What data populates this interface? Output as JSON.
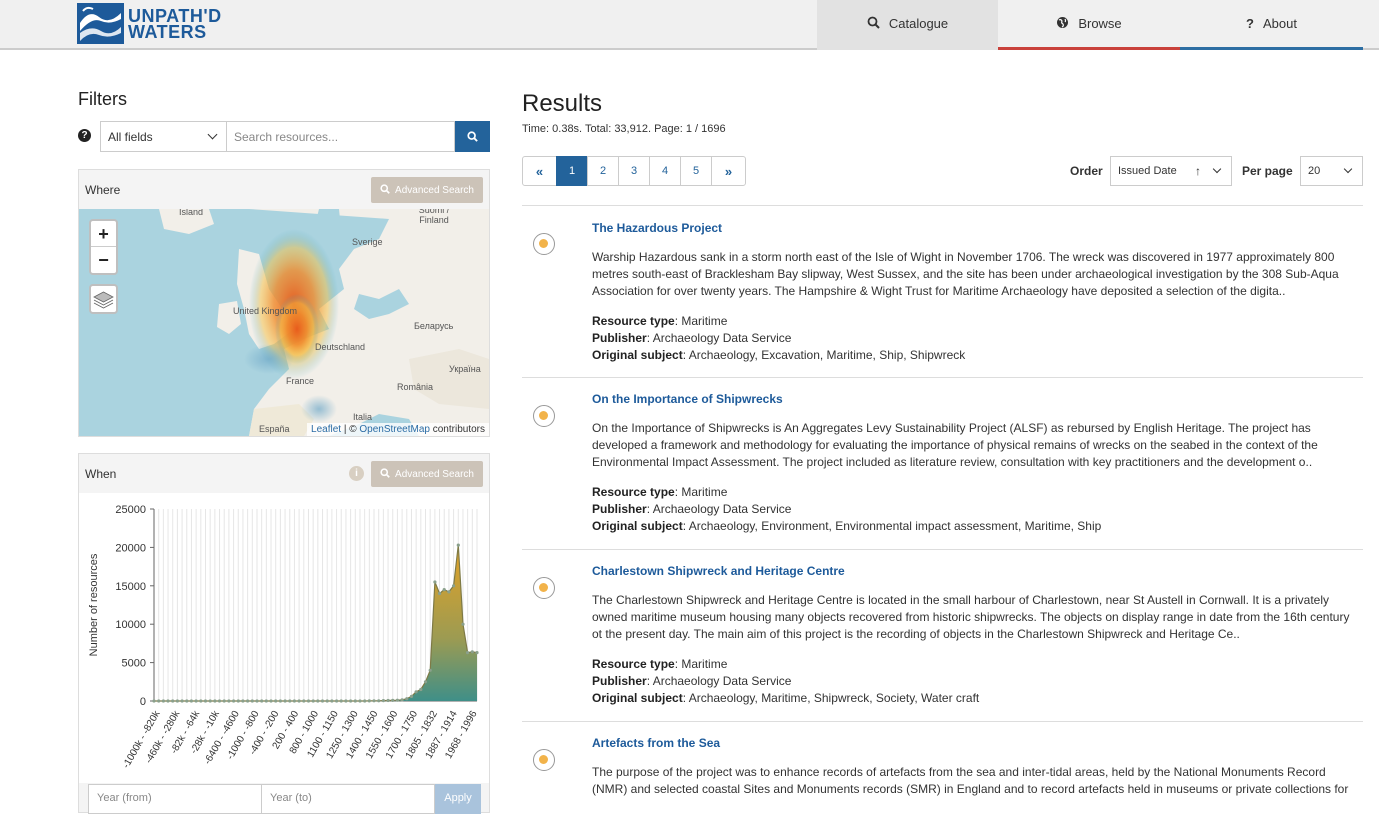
{
  "header": {
    "logo": {
      "line1": "UNPATH'D",
      "line2": "WATERS"
    },
    "nav": [
      {
        "label": "Catalogue",
        "icon": "search-icon"
      },
      {
        "label": "Browse",
        "icon": "globe-icon"
      },
      {
        "label": "About",
        "icon": "question-icon"
      }
    ]
  },
  "filters": {
    "title": "Filters",
    "field_select": "All fields",
    "search_placeholder": "Search resources...",
    "where_label": "Where",
    "when_label": "When",
    "advanced_search": "Advanced Search",
    "map_attribution": {
      "leaflet": "Leaflet",
      "sep": " | © ",
      "osm": "OpenStreetMap",
      "suffix": " contributors"
    },
    "map_labels": [
      "Ísland",
      "Suomi / Finland",
      "Sverige",
      "United Kingdom",
      "Беларусь",
      "Deutschland",
      "France",
      "România",
      "Україна",
      "Italia",
      "España"
    ],
    "year_from_placeholder": "Year (from)",
    "year_to_placeholder": "Year (to)",
    "apply": "Apply"
  },
  "chart_data": {
    "type": "area",
    "ylabel": "Number of resources",
    "xlabel": "",
    "ylim": [
      0,
      25000
    ],
    "yticks": [
      0,
      5000,
      10000,
      15000,
      20000,
      25000
    ],
    "tick_labels": [
      "-1000k - -820k",
      "-460k - -280k",
      "-82k - -64k",
      "-28k - -10k",
      "-6400 - -4600",
      "-1000 - -800",
      "-400 - -200",
      "200 - 400",
      "800 - 1000",
      "1100 - 1150",
      "1250 - 1300",
      "1400 - 1450",
      "1550 - 1600",
      "1700 - 1750",
      "1805 - 1832",
      "1887 - 1914",
      "1968 - 1996"
    ],
    "x": [
      0,
      1,
      2,
      3,
      4,
      5,
      6,
      7,
      8,
      9,
      10,
      11,
      12,
      13,
      14,
      15,
      16,
      17,
      18,
      19,
      20,
      21,
      22,
      23,
      24,
      25,
      26,
      27,
      28,
      29,
      30,
      31,
      32,
      33,
      34,
      35,
      36,
      37,
      38,
      39,
      40,
      41,
      42,
      43,
      44,
      45,
      46,
      47,
      48,
      49,
      50,
      51,
      52,
      53,
      54,
      55,
      56,
      57,
      58,
      59,
      60,
      61,
      62,
      63,
      64,
      65,
      66,
      67,
      68,
      69
    ],
    "values": [
      0,
      0,
      0,
      0,
      0,
      0,
      0,
      0,
      0,
      0,
      0,
      0,
      0,
      0,
      0,
      0,
      0,
      0,
      0,
      0,
      0,
      0,
      0,
      0,
      0,
      0,
      0,
      0,
      0,
      0,
      0,
      0,
      0,
      0,
      0,
      0,
      0,
      0,
      0,
      0,
      0,
      0,
      0,
      0,
      0,
      0,
      10,
      20,
      30,
      50,
      60,
      80,
      100,
      150,
      300,
      600,
      1200,
      1500,
      2500,
      4000,
      15500,
      14000,
      14500,
      14200,
      15000,
      20300,
      10000,
      6300,
      6400,
      6300
    ]
  },
  "results": {
    "title": "Results",
    "meta": "Time: 0.38s. Total: 33,912. Page: 1 / 1696",
    "pages": [
      "«",
      "1",
      "2",
      "3",
      "4",
      "5",
      "»"
    ],
    "order_label": "Order",
    "order_value": "Issued Date",
    "per_page_label": "Per page",
    "per_page_value": "20",
    "items": [
      {
        "title": "The Hazardous Project",
        "description": "Warship Hazardous sank in a storm north east of the Isle of Wight in November 1706. The wreck was discovered in 1977 approximately 800 metres south-east of Bracklesham Bay slipway, West Sussex, and the site has been under archaeological investigation by the 308 Sub-Aqua Association for over twenty years. The Hampshire & Wight Trust for Maritime Archaeology have deposited a selection of the digita..",
        "resource_type": "Maritime",
        "publisher": "Archaeology Data Service",
        "subject": "Archaeology, Excavation, Maritime, Ship, Shipwreck"
      },
      {
        "title": "On the Importance of Shipwrecks",
        "description": "On the Importance of Shipwrecks is An Aggregates Levy Sustainability Project (ALSF) as rebursed by English Heritage. The project has developed a framework and methodology for evaluating the importance of physical remains of wrecks on the seabed in the context of the Environmental Impact Assessment. The project included as literature review, consultation with key practitioners and the development o..",
        "resource_type": "Maritime",
        "publisher": "Archaeology Data Service",
        "subject": "Archaeology, Environment, Environmental impact assessment, Maritime, Ship"
      },
      {
        "title": "Charlestown Shipwreck and Heritage Centre",
        "description": "The Charlestown Shipwreck and Heritage Centre is located in the small harbour of Charlestown, near St Austell in Cornwall. It is a privately owned maritime museum housing many objects recovered from historic shipwrecks. The objects on display range in date from the 16th century ot the present day. The main aim of this project is the recording of objects in the Charlestown Shipwreck and Heritage Ce..",
        "resource_type": "Maritime",
        "publisher": "Archaeology Data Service",
        "subject": "Archaeology, Maritime, Shipwreck, Society, Water craft"
      },
      {
        "title": "Artefacts from the Sea",
        "description": "The purpose of the project was to enhance records of artefacts from the sea and inter-tidal areas, held by the National Monuments Record (NMR) and selected coastal Sites and Monuments records (SMR) in England and to record artefacts held in museums or private collections for inclusion into"
      }
    ],
    "labels": {
      "resource_type": "Resource type",
      "publisher": "Publisher",
      "subject": "Original subject"
    }
  }
}
